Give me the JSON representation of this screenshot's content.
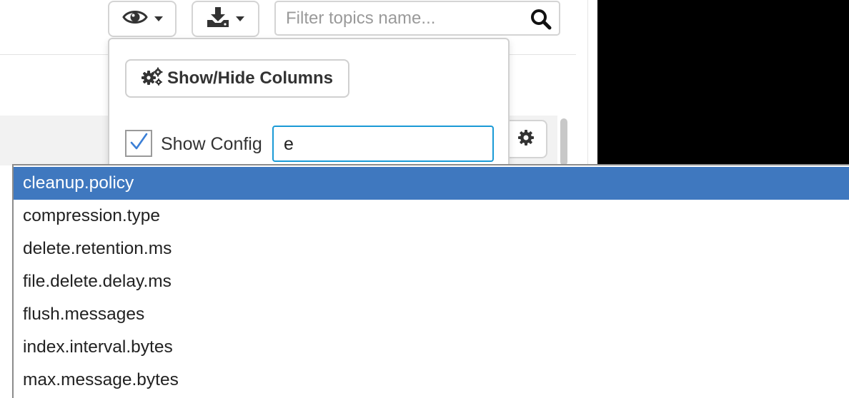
{
  "toolbar": {
    "view_icon": "eye-icon",
    "download_icon": "download-icon",
    "search_placeholder": "Filter topics name...",
    "search_value": "",
    "search_icon": "search-icon"
  },
  "columns_menu": {
    "show_hide_label": "Show/Hide Columns",
    "show_hide_icon": "gears-icon",
    "show_config_label": "Show Config",
    "show_config_checked": true,
    "config_filter_value": "e"
  },
  "row_actions": {
    "settings_icon": "gear-icon"
  },
  "autocomplete": {
    "items": [
      "cleanup.policy",
      "compression.type",
      "delete.retention.ms",
      "file.delete.delay.ms",
      "flush.messages",
      "index.interval.bytes",
      "max.message.bytes"
    ],
    "selected_index": 0,
    "highlight_color": "#3f78bf"
  },
  "colors": {
    "focus_border": "#1a9ad6",
    "checkmark": "#3b7fd6"
  }
}
